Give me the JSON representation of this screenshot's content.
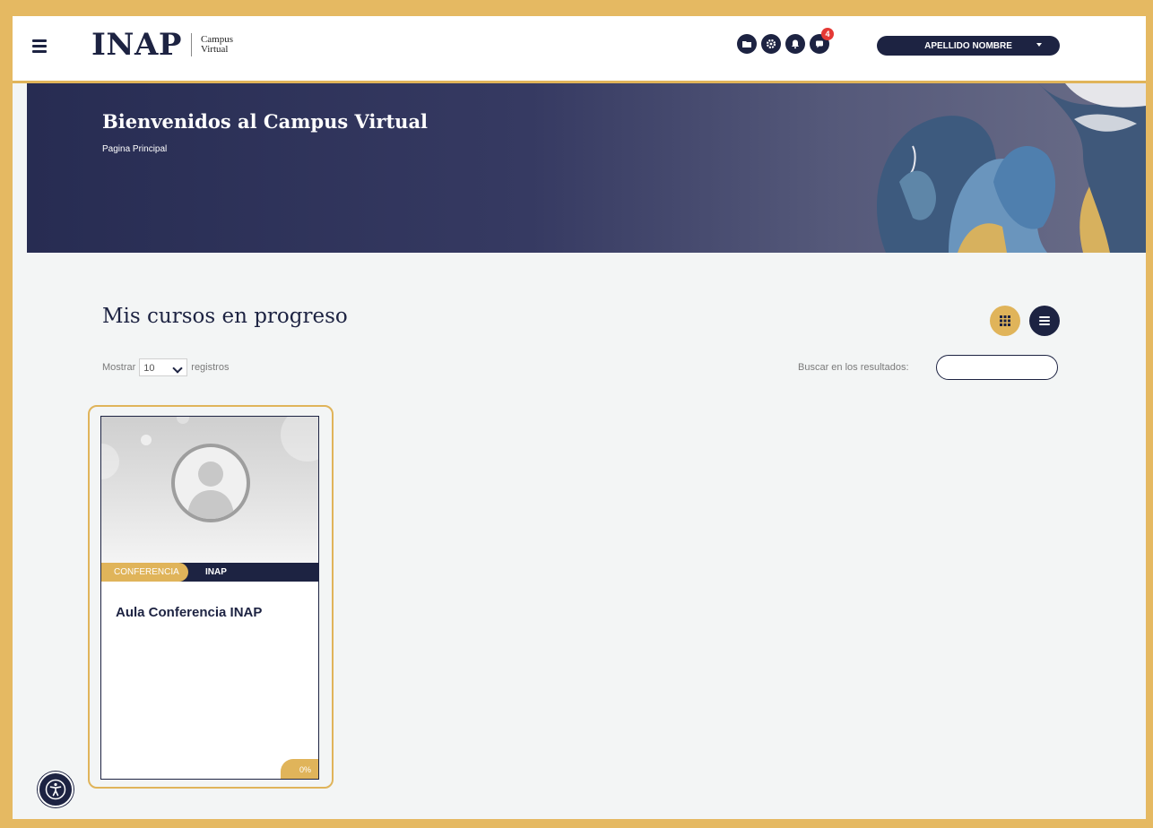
{
  "header": {
    "logo_main": "INAP",
    "logo_sub_line1": "Campus",
    "logo_sub_line2": "Virtual",
    "icons": [
      "folder-icon",
      "gear-icon",
      "bell-icon",
      "chat-icon"
    ],
    "notification_count": "4",
    "user_name": "APELLIDO NOMBRE"
  },
  "banner": {
    "title": "Bienvenidos al Campus Virtual",
    "subtitle": "Pagina Principal"
  },
  "main": {
    "section_title": "Mis cursos en progreso",
    "show_prefix": "Mostrar",
    "show_value": "10",
    "show_suffix": "registros",
    "search_label": "Buscar en los resultados:",
    "search_value": ""
  },
  "courses": [
    {
      "category": "CONFERENCIA",
      "institution": "INAP",
      "title": "Aula Conferencia INAP",
      "progress": "0%"
    }
  ],
  "colors": {
    "navy": "#1d2342",
    "gold": "#e0b45a",
    "notification": "#e53935"
  }
}
